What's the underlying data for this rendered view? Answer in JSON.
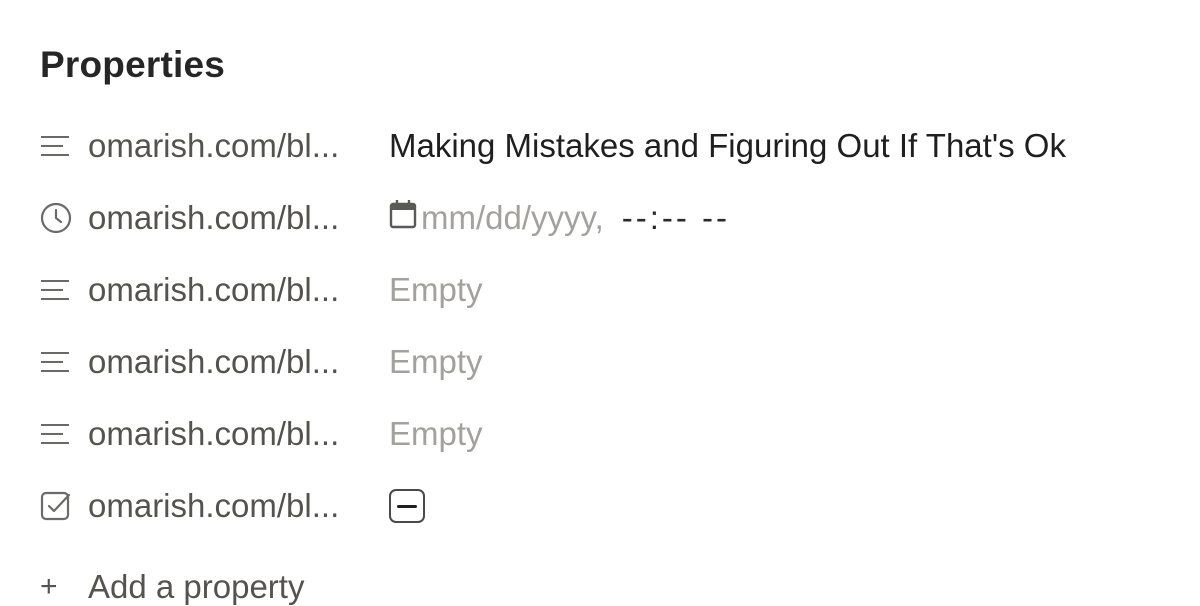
{
  "section_title": "Properties",
  "rows": [
    {
      "icon": "text-lines-icon",
      "key": "omarish.com/bl...",
      "value": "Making Mistakes and Figuring Out If That's Ok",
      "state": "filled"
    },
    {
      "icon": "clock-icon",
      "key": "omarish.com/bl...",
      "date_placeholder": "mm/dd/yyyy,",
      "time_placeholder": "--:-- --",
      "state": "date"
    },
    {
      "icon": "text-lines-icon",
      "key": "omarish.com/bl...",
      "value": "Empty",
      "state": "empty"
    },
    {
      "icon": "text-lines-icon",
      "key": "omarish.com/bl...",
      "value": "Empty",
      "state": "empty"
    },
    {
      "icon": "text-lines-icon",
      "key": "omarish.com/bl...",
      "value": "Empty",
      "state": "empty"
    },
    {
      "icon": "checkbox-icon",
      "key": "omarish.com/bl...",
      "checkbox_state": "indeterminate",
      "state": "checkbox"
    }
  ],
  "add_property": {
    "label": "Add a property",
    "icon": "plus-icon"
  },
  "colors": {
    "text_primary": "#1f1f1f",
    "text_secondary": "#55534e",
    "text_placeholder": "#a3a19c"
  }
}
